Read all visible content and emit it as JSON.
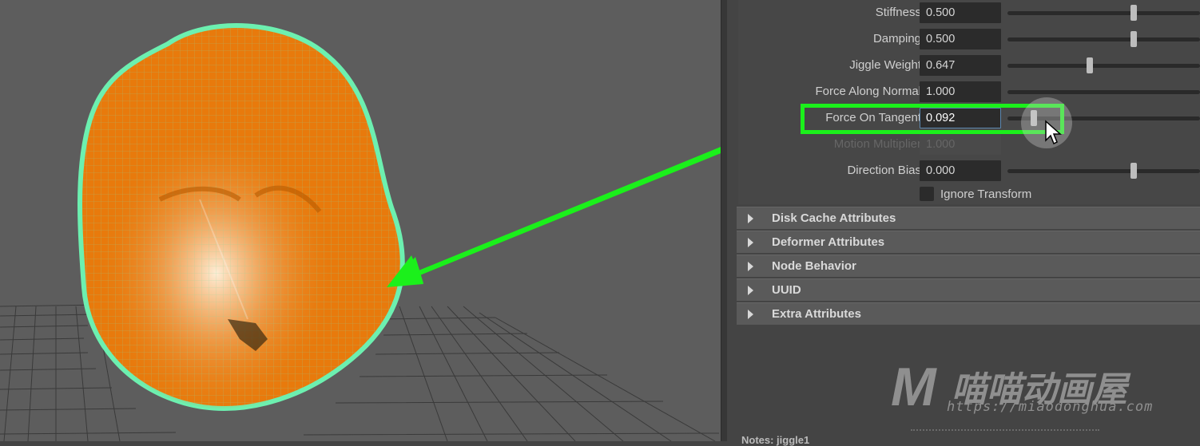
{
  "attributes": {
    "rows": [
      {
        "label": "Stiffness",
        "value": "0.500",
        "slider": 0.5
      },
      {
        "label": "Damping",
        "value": "0.500",
        "slider": 0.5
      },
      {
        "label": "Jiggle Weight",
        "value": "0.647",
        "slider": 0.647
      },
      {
        "label": "Force Along Normal",
        "value": "1.000",
        "slider": 1.0
      },
      {
        "label": "Force On Tangent",
        "value": "0.092",
        "slider": 0.092
      },
      {
        "label": "Motion Multiplier",
        "value": "1.000",
        "slider": null
      },
      {
        "label": "Direction Bias",
        "value": "0.000",
        "slider": 0.0
      }
    ],
    "ignore_transform": {
      "label": "Ignore Transform",
      "checked": false
    }
  },
  "sections": [
    {
      "title": "Disk Cache Attributes"
    },
    {
      "title": "Deformer Attributes"
    },
    {
      "title": "Node Behavior"
    },
    {
      "title": "UUID"
    },
    {
      "title": "Extra Attributes"
    }
  ],
  "bottom_partial_label": "Notes: jiggle1",
  "watermark": {
    "letter": "M",
    "brand": "喵喵动画屋",
    "url": "https://miaodonghua.com"
  },
  "colors": {
    "annotation": "#1bf01b",
    "mesh_fill": "#e87a0c",
    "wireframe": "#6cf0b0",
    "viewport_bg": "#5d5d5d"
  },
  "icons": [
    "mouse-cursor-icon",
    "expand-triangle-icon"
  ]
}
